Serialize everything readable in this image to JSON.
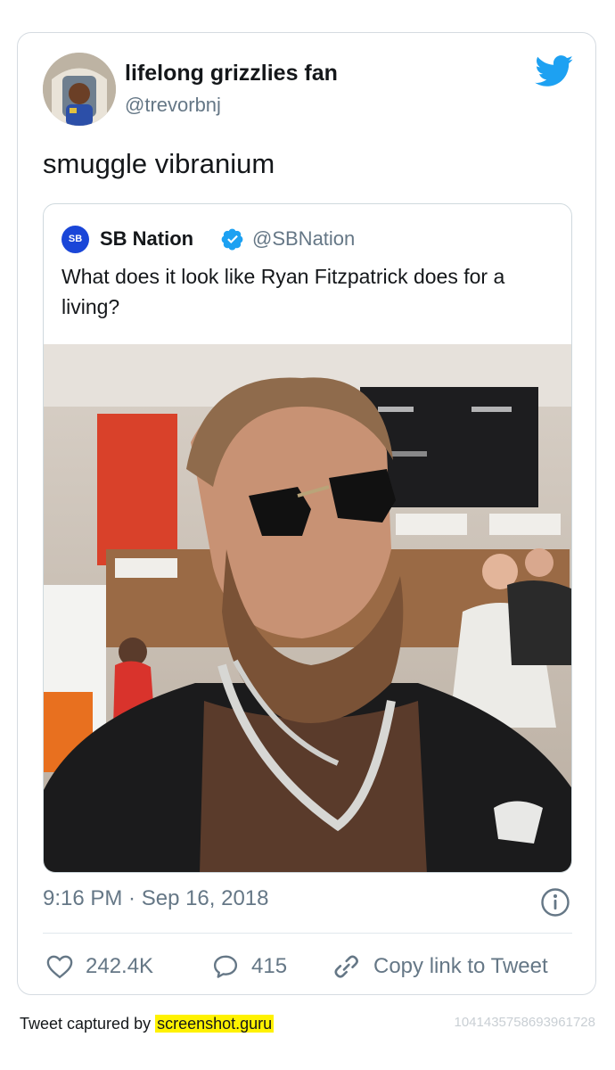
{
  "tweet": {
    "author_name": "lifelong grizzlies fan",
    "author_handle": "@trevorbnj",
    "text": "smuggle vibranium",
    "timestamp": "9:16 PM · Sep 16, 2018",
    "likes": "242.4K",
    "replies": "415",
    "copy_link_label": "Copy link to Tweet"
  },
  "quoted_tweet": {
    "author_name": "SB Nation",
    "author_handle": "@SBNation",
    "logo_text": "SB",
    "text": "What does it look like Ryan Fitzpatrick does for a living?"
  },
  "footer": {
    "captured_by": "Tweet captured by",
    "site": "screenshot.guru",
    "tweet_id": "1041435758693961728"
  },
  "colors": {
    "twitter_blue": "#1da1f2",
    "text_primary": "#14171a",
    "text_secondary": "#657786",
    "highlight": "#fff200"
  },
  "icons": [
    "twitter-bird-icon",
    "verified-badge-icon",
    "info-icon",
    "heart-icon",
    "reply-icon",
    "link-icon"
  ]
}
